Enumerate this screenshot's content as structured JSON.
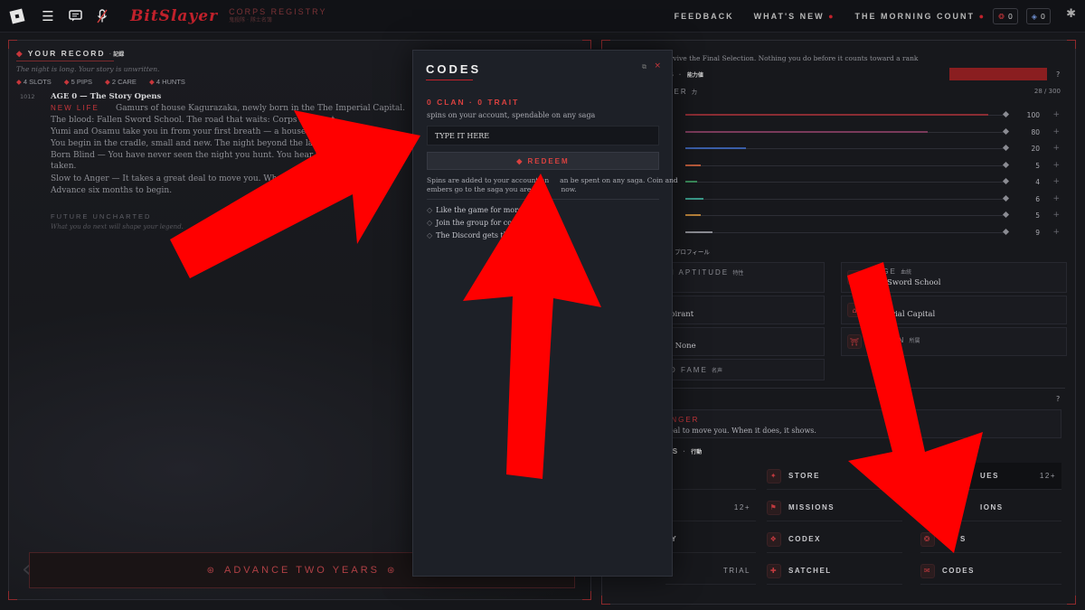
{
  "topbar": {
    "brand": "BitSlayer",
    "brand_sub_1": "CORPS REGISTRY",
    "brand_sub_2": "鬼殺隊 · 隊士名簿",
    "nav": [
      {
        "label": "FEEDBACK",
        "dot": ""
      },
      {
        "label": "WHAT'S NEW",
        "dot": "●"
      },
      {
        "label": "THE MORNING COUNT",
        "dot": "●"
      }
    ],
    "currency_a": "0",
    "currency_b": "0"
  },
  "record": {
    "title": "YOUR RECORD",
    "title_jp": "記録",
    "tagline": "The night is long. Your story is unwritten.",
    "chips": [
      "4 SLOTS",
      "5 PIPS",
      "2 CARE",
      "4 HUNTS"
    ],
    "year": "1012",
    "age_head": "AGE 0 — The Story Opens",
    "new_life_label": "NEW LIFE",
    "lines": [
      "Gamurs of house Kagurazaka, newly born in the The Imperial Capital.",
      "The blood: Fallen Sword School. The road that waits: Corps Aspirant.",
      "Yumi and Osamu take you in from your first breath — a house of w",
      "You begin in the cradle, small and new. The night beyond the lantern",
      "Born Blind — You have never seen the night you hunt. You hear it bett",
      "taken.",
      "Slow to Anger — It takes a great deal to move you. When it does, it sh",
      "Advance six months to begin."
    ],
    "future_label": "FUTURE UNCHARTED",
    "future_text": "What you do next will shape your legend.",
    "advance_label": "ADVANCE TWO YEARS"
  },
  "right": {
    "top_text": "urvive the Final Selection. Nothing you do before it counts toward a rank",
    "section_es": "ES",
    "section_es_jp": "能力値",
    "power_label": "WER",
    "power_jp": "力",
    "power_counter": "28 / 300",
    "stats": [
      {
        "value": "100",
        "fraction": 1.0,
        "color": "#8a2c33"
      },
      {
        "value": "80",
        "fraction": 0.8,
        "color": "#7a3a5a"
      },
      {
        "value": "20",
        "fraction": 0.2,
        "color": "#3a5ea8"
      },
      {
        "value": "5",
        "fraction": 0.05,
        "color": "#b85a3a"
      },
      {
        "value": "4",
        "fraction": 0.04,
        "color": "#3a8a5a"
      },
      {
        "value": "6",
        "fraction": 0.06,
        "color": "#3a9a8a"
      },
      {
        "value": "5",
        "fraction": 0.05,
        "color": "#b8823a"
      },
      {
        "value": "9",
        "fraction": 0.09,
        "color": "#8a8b92"
      }
    ],
    "profile_head": "プロフィール",
    "profile": {
      "aptitude_label": "H APTITUDE",
      "aptitude_jp": "特性",
      "lineage_label": "AGE",
      "lineage_jp": "血統",
      "lineage_value": "Sword School",
      "rank_value": "pirant",
      "home_value": "rial Capital",
      "clan_value": "- None",
      "fame_label": "D FAME",
      "fame_jp": "名声",
      "affil_label": "ION",
      "affil_jp": "所属"
    },
    "trait_label": "ANGER",
    "trait_text": "deal to move you. When it does, it shows.",
    "actions_head": "NS",
    "actions_jp": "行動",
    "buttons": [
      {
        "col1": "T",
        "col2": "STORE",
        "col3": "UES",
        "col3_badge": "12+"
      },
      {
        "col1": "G",
        "col1_badge": "12+",
        "col2": "MISSIONS",
        "col3": "IONS"
      },
      {
        "col1": "TY",
        "col2": "CODEX",
        "col3": "S"
      },
      {
        "col1_badge": "TRIAL",
        "col2": "SATCHEL",
        "col3": "CODES"
      }
    ]
  },
  "modal": {
    "title": "CODES",
    "close": "×",
    "spins": "0 CLAN · 0 TRAIT",
    "spins_sub": "spins on your account, spendable on any saga",
    "input_placeholder": "TYPE IT HERE",
    "redeem_label": "REDEEM",
    "note_line1": "Spins are added to your account an     an be spent on any saga. Coin and",
    "note_line2": "embers go to the saga you are pla        now.",
    "list": [
      "Like the game for more cod",
      "Join the group for codes",
      "The Discord gets them"
    ]
  }
}
